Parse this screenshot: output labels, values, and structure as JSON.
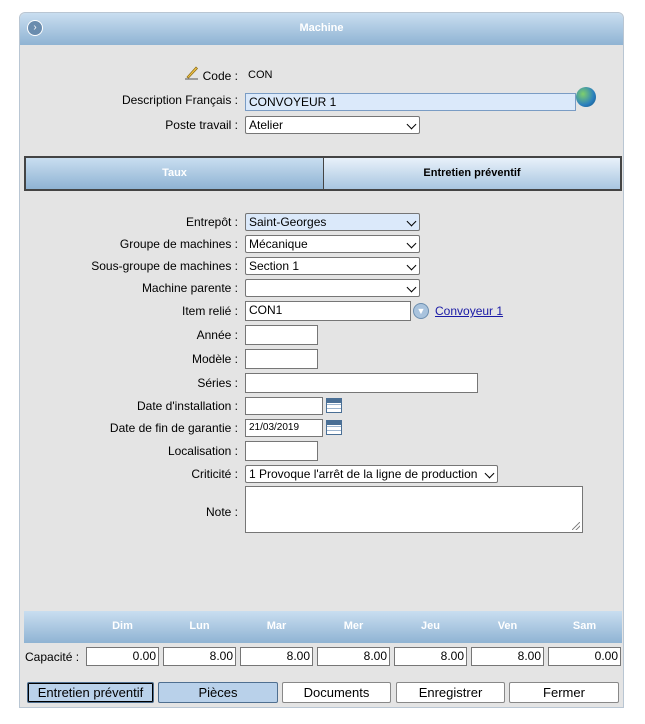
{
  "header": {
    "title": "Machine"
  },
  "top": {
    "code_label": "Code :",
    "code_value": "CON",
    "desc_label": "Description Français :",
    "desc_value": "CONVOYEUR 1",
    "poste_label": "Poste travail :",
    "poste_value": "Atelier"
  },
  "tabs": [
    {
      "label": "Taux"
    },
    {
      "label": "Entretien préventif"
    }
  ],
  "form": {
    "entrepot_label": "Entrepôt :",
    "entrepot_value": "Saint-Georges",
    "groupe_label": "Groupe de machines :",
    "groupe_value": "Mécanique",
    "sousgroupe_label": "Sous-groupe de machines :",
    "sousgroupe_value": "Section 1",
    "parente_label": "Machine parente :",
    "parente_value": "",
    "item_label": "Item relié :",
    "item_value": "CON1",
    "item_link": "Convoyeur 1",
    "annee_label": "Année :",
    "annee_value": "",
    "modele_label": "Modèle :",
    "modele_value": "",
    "series_label": "Séries :",
    "series_value": "",
    "install_label": "Date d'installation :",
    "install_value": "",
    "garantie_label": "Date de fin de garantie :",
    "garantie_value": "21/03/2019",
    "local_label": "Localisation :",
    "local_value": "",
    "criticite_label": "Criticité :",
    "criticite_value": "1 Provoque l'arrêt de la ligne de production",
    "note_label": "Note :",
    "note_value": ""
  },
  "capacity": {
    "label": "Capacité :",
    "days": [
      "Dim",
      "Lun",
      "Mar",
      "Mer",
      "Jeu",
      "Ven",
      "Sam"
    ],
    "values": [
      "0.00",
      "8.00",
      "8.00",
      "8.00",
      "8.00",
      "8.00",
      "0.00"
    ]
  },
  "buttons": {
    "entretien": "Entretien préventif",
    "pieces": "Pièces",
    "documents": "Documents",
    "enregistrer": "Enregistrer",
    "fermer": "Fermer"
  }
}
